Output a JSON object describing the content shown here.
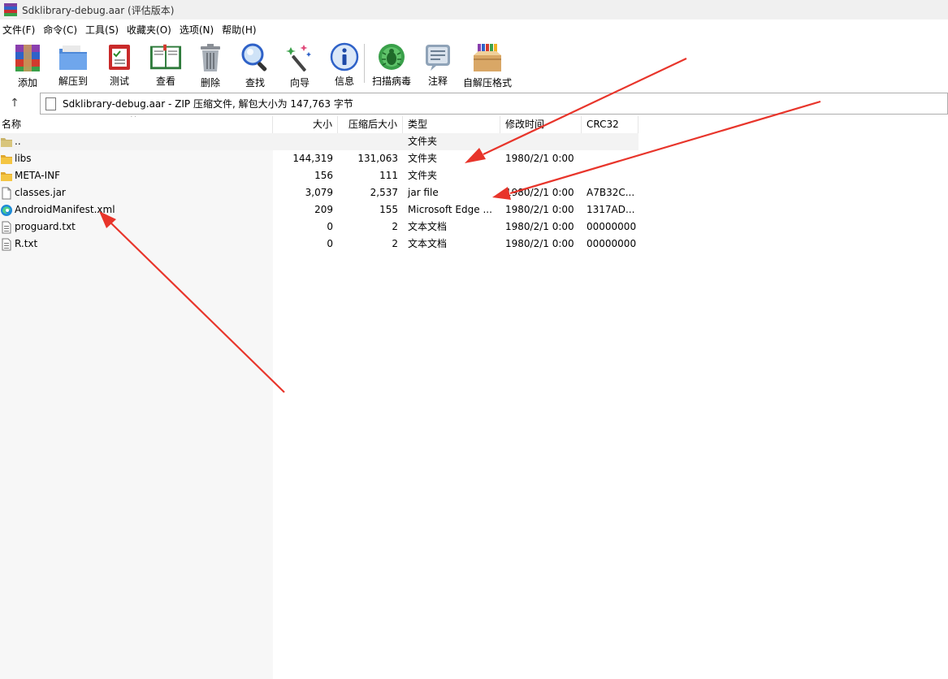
{
  "window": {
    "title": "Sdklibrary-debug.aar (评估版本)"
  },
  "menu": [
    "文件(F)",
    "命令(C)",
    "工具(S)",
    "收藏夹(O)",
    "选项(N)",
    "帮助(H)"
  ],
  "toolbar": [
    {
      "label": "添加",
      "icon": "add-archive-icon"
    },
    {
      "label": "解压到",
      "icon": "extract-to-icon"
    },
    {
      "label": "测试",
      "icon": "test-icon"
    },
    {
      "label": "查看",
      "icon": "view-book-icon"
    },
    {
      "label": "删除",
      "icon": "trash-icon"
    },
    {
      "label": "查找",
      "icon": "magnifier-icon"
    },
    {
      "label": "向导",
      "icon": "wizard-icon"
    },
    {
      "label": "信息",
      "icon": "info-icon"
    },
    {
      "label": "扫描病毒",
      "icon": "virus-scan-icon"
    },
    {
      "label": "注释",
      "icon": "comment-icon"
    },
    {
      "label": "自解压格式",
      "icon": "sfx-box-icon"
    }
  ],
  "address": {
    "text": "Sdklibrary-debug.aar - ZIP 压缩文件, 解包大小为 147,763 字节"
  },
  "columns": {
    "name": "名称",
    "size": "大小",
    "packed": "压缩后大小",
    "type": "类型",
    "modified": "修改时间",
    "crc": "CRC32"
  },
  "files": [
    {
      "name": "..",
      "size": "",
      "packed": "",
      "type": "文件夹",
      "modified": "",
      "crc": "",
      "icon": "parent-folder-icon"
    },
    {
      "name": "libs",
      "size": "144,319",
      "packed": "131,063",
      "type": "文件夹",
      "modified": "1980/2/1 0:00",
      "crc": "",
      "icon": "folder-icon"
    },
    {
      "name": "META-INF",
      "size": "156",
      "packed": "111",
      "type": "文件夹",
      "modified": "",
      "crc": "",
      "icon": "folder-icon"
    },
    {
      "name": "classes.jar",
      "size": "3,079",
      "packed": "2,537",
      "type": "jar file",
      "modified": "1980/2/1 0:00",
      "crc": "A7B32C...",
      "icon": "file-icon"
    },
    {
      "name": "AndroidManifest.xml",
      "size": "209",
      "packed": "155",
      "type": "Microsoft Edge ...",
      "modified": "1980/2/1 0:00",
      "crc": "1317AD...",
      "icon": "edge-icon"
    },
    {
      "name": "proguard.txt",
      "size": "0",
      "packed": "2",
      "type": "文本文档",
      "modified": "1980/2/1 0:00",
      "crc": "00000000",
      "icon": "text-file-icon"
    },
    {
      "name": "R.txt",
      "size": "0",
      "packed": "2",
      "type": "文本文档",
      "modified": "1980/2/1 0:00",
      "crc": "00000000",
      "icon": "text-file-icon"
    }
  ],
  "colors": {
    "folder": "#f4c542",
    "annotation_arrow": "#e8352b",
    "titlebar": "#f0f0f0"
  }
}
